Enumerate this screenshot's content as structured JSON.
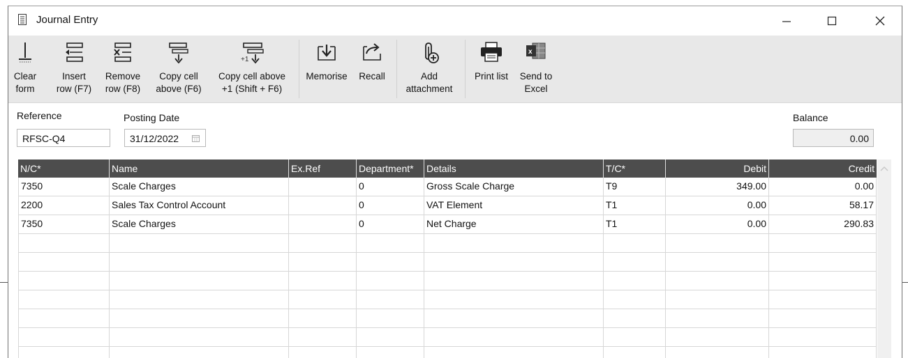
{
  "window": {
    "title": "Journal Entry"
  },
  "toolbar": {
    "items": [
      {
        "label": "Clear\nform",
        "icon": "clear-form-icon"
      },
      {
        "label": "Insert\nrow (F7)",
        "icon": "insert-row-icon"
      },
      {
        "label": "Remove\nrow (F8)",
        "icon": "remove-row-icon"
      },
      {
        "label": "Copy cell\nabove (F6)",
        "icon": "copy-cell-above-icon"
      },
      {
        "label": "Copy cell above\n+1 (Shift + F6)",
        "icon": "copy-cell-above-plus-one-icon"
      },
      {
        "label": "Memorise",
        "icon": "memorise-icon"
      },
      {
        "label": "Recall",
        "icon": "recall-icon"
      },
      {
        "label": "Add\nattachment",
        "icon": "paperclip-icon"
      },
      {
        "label": "Print list",
        "icon": "printer-icon"
      },
      {
        "label": "Send to\nExcel",
        "icon": "excel-icon"
      }
    ]
  },
  "form": {
    "reference_label": "Reference",
    "reference_value": "RFSC-Q4",
    "posting_date_label": "Posting Date",
    "posting_date_value": "31/12/2022",
    "balance_label": "Balance",
    "balance_value": "0.00"
  },
  "grid": {
    "columns": [
      "N/C*",
      "Name",
      "Ex.Ref",
      "Department*",
      "Details",
      "T/C*",
      "Debit",
      "Credit"
    ],
    "rows": [
      [
        "7350",
        "Scale Charges",
        "",
        "0",
        "Gross Scale Charge",
        "T9",
        "349.00",
        "0.00"
      ],
      [
        "2200",
        "Sales Tax Control Account",
        "",
        "0",
        "VAT Element",
        "T1",
        "0.00",
        "58.17"
      ],
      [
        "7350",
        "Scale Charges",
        "",
        "0",
        "Net Charge",
        "T1",
        "0.00",
        "290.83"
      ],
      [
        "",
        "",
        "",
        "",
        "",
        "",
        "",
        ""
      ],
      [
        "",
        "",
        "",
        "",
        "",
        "",
        "",
        ""
      ],
      [
        "",
        "",
        "",
        "",
        "",
        "",
        "",
        ""
      ],
      [
        "",
        "",
        "",
        "",
        "",
        "",
        "",
        ""
      ],
      [
        "",
        "",
        "",
        "",
        "",
        "",
        "",
        ""
      ],
      [
        "",
        "",
        "",
        "",
        "",
        "",
        "",
        ""
      ],
      [
        "",
        "",
        "",
        "",
        "",
        "",
        "",
        ""
      ]
    ]
  }
}
